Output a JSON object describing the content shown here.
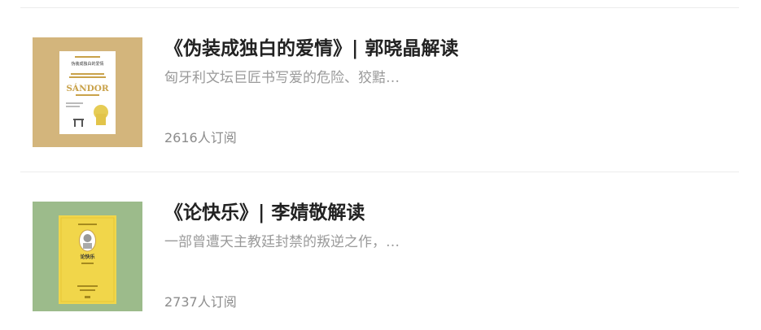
{
  "books": [
    {
      "title": "《伪装成独白的爱情》| 郭晓晶解读",
      "description": "匈牙利文坛巨匠书写爱的危险、狡黠…",
      "subscribers": "2616人订阅",
      "cover": {
        "background": "#d3b57c",
        "book_color": "#ffffff",
        "accent": "#c9a24a",
        "top_text": "伪装成独白的爱情",
        "author_text": "SÁNDOR"
      }
    },
    {
      "title": "《论快乐》| 李婧敬解读",
      "description": "一部曾遭天主教廷封禁的叛逆之作，…",
      "subscribers": "2737人订阅",
      "cover": {
        "background": "#9cbb8b",
        "book_color": "#f1d64a",
        "accent": "#e6c636",
        "top_text": "论快乐"
      }
    }
  ]
}
